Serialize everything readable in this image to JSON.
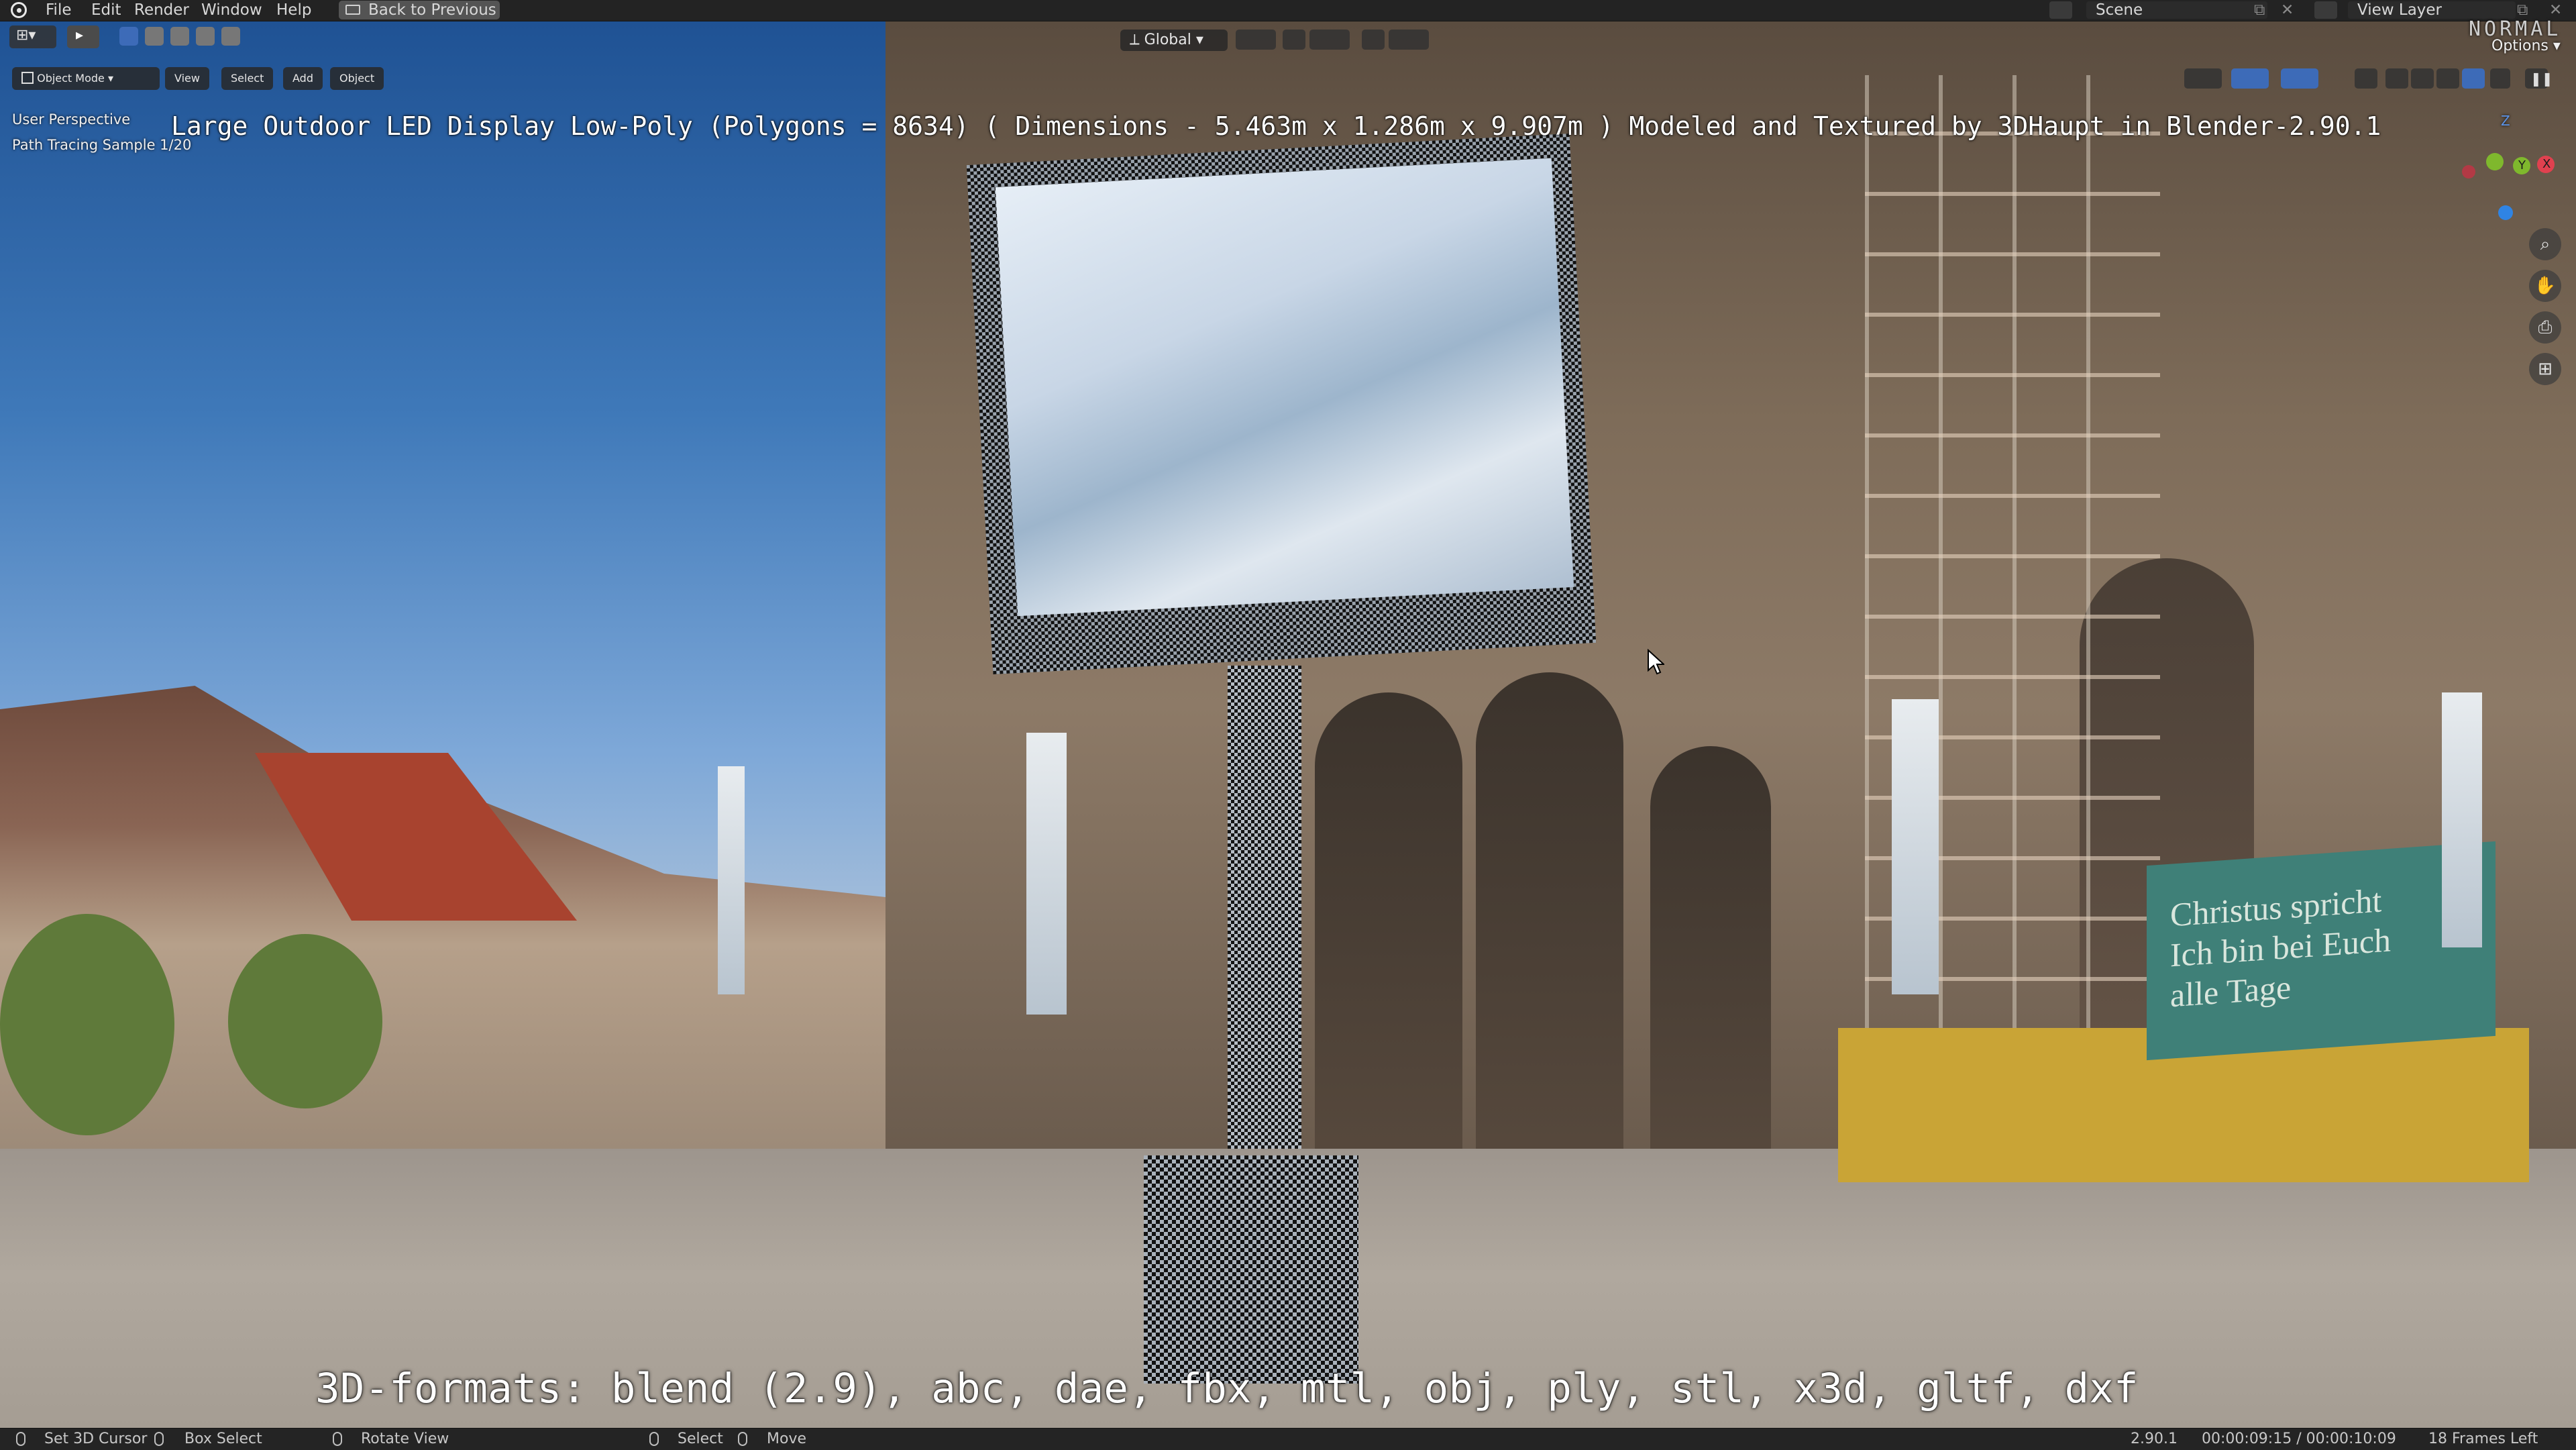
{
  "menubar": {
    "items": [
      "File",
      "Edit",
      "Render",
      "Window",
      "Help"
    ],
    "back_button": "Back to Previous",
    "scene": "Scene",
    "view_layer": "View Layer",
    "normal_badge": "NORMAL",
    "options": "Options"
  },
  "viewport_header": {
    "mode": "Object Mode",
    "menus": [
      "View",
      "Select",
      "Add",
      "Object"
    ],
    "transform_orientation": "Global"
  },
  "viewport": {
    "perspective": "User Perspective",
    "sample_info": "Path Tracing Sample 1/20",
    "title_overlay": "Large Outdoor LED Display Low-Poly (Polygons = 8634) ( Dimensions -  5.463m x 1.286m x 9.907m ) Modeled and Textured by 3DHaupt in Blender-2.90.1",
    "formats_overlay": "3D-formats: blend (2.9), abc, dae, fbx, mtl, obj, ply, stl, x3d, gltf, dxf",
    "banner_text": [
      "Christus spricht",
      "Ich bin bei Euch",
      "alle Tage"
    ],
    "gizmo_axes": {
      "x": "X",
      "y": "Y",
      "z": "Z"
    },
    "colors": {
      "x_axis": "#e0414f",
      "y_axis": "#7fb82d",
      "z_axis": "#2f84e4"
    }
  },
  "statusbar": {
    "hints": [
      {
        "label": "Set 3D Cursor",
        "icon": "mouse-left-icon"
      },
      {
        "label": "Box Select",
        "icon": "mouse-drag-icon"
      },
      {
        "label": "Rotate View",
        "icon": "mouse-middle-icon"
      },
      {
        "label": "Select",
        "icon": "mouse-left-icon"
      },
      {
        "label": "Move",
        "icon": "mouse-drag-icon"
      }
    ],
    "version": "2.90.1",
    "time": "00:00:09:15 / 00:00:10:09",
    "frames_left": "18 Frames Left"
  }
}
